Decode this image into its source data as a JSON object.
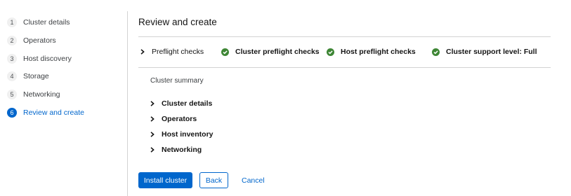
{
  "wizard": {
    "steps": [
      {
        "number": "1",
        "label": "Cluster details"
      },
      {
        "number": "2",
        "label": "Operators"
      },
      {
        "number": "3",
        "label": "Host discovery"
      },
      {
        "number": "4",
        "label": "Storage"
      },
      {
        "number": "5",
        "label": "Networking"
      },
      {
        "number": "6",
        "label": "Review and create"
      }
    ],
    "current_step": "6"
  },
  "main": {
    "title": "Review and create",
    "preflight": {
      "label": "Preflight checks",
      "checks": [
        {
          "label": "Cluster preflight checks",
          "status": "success",
          "icon": "check-circle-icon"
        },
        {
          "label": "Host preflight checks",
          "status": "success",
          "icon": "check-circle-icon"
        },
        {
          "label": "Cluster support level: Full",
          "status": "success",
          "icon": "check-circle-icon"
        }
      ]
    },
    "summary": {
      "label": "Cluster summary",
      "sections": [
        {
          "label": "Cluster details"
        },
        {
          "label": "Operators"
        },
        {
          "label": "Host inventory"
        },
        {
          "label": "Networking"
        }
      ]
    }
  },
  "footer": {
    "install_label": "Install cluster",
    "back_label": "Back",
    "cancel_label": "Cancel"
  },
  "colors": {
    "accent": "#0066cc",
    "success": "#3e8635",
    "divider": "#d2d2d2"
  }
}
